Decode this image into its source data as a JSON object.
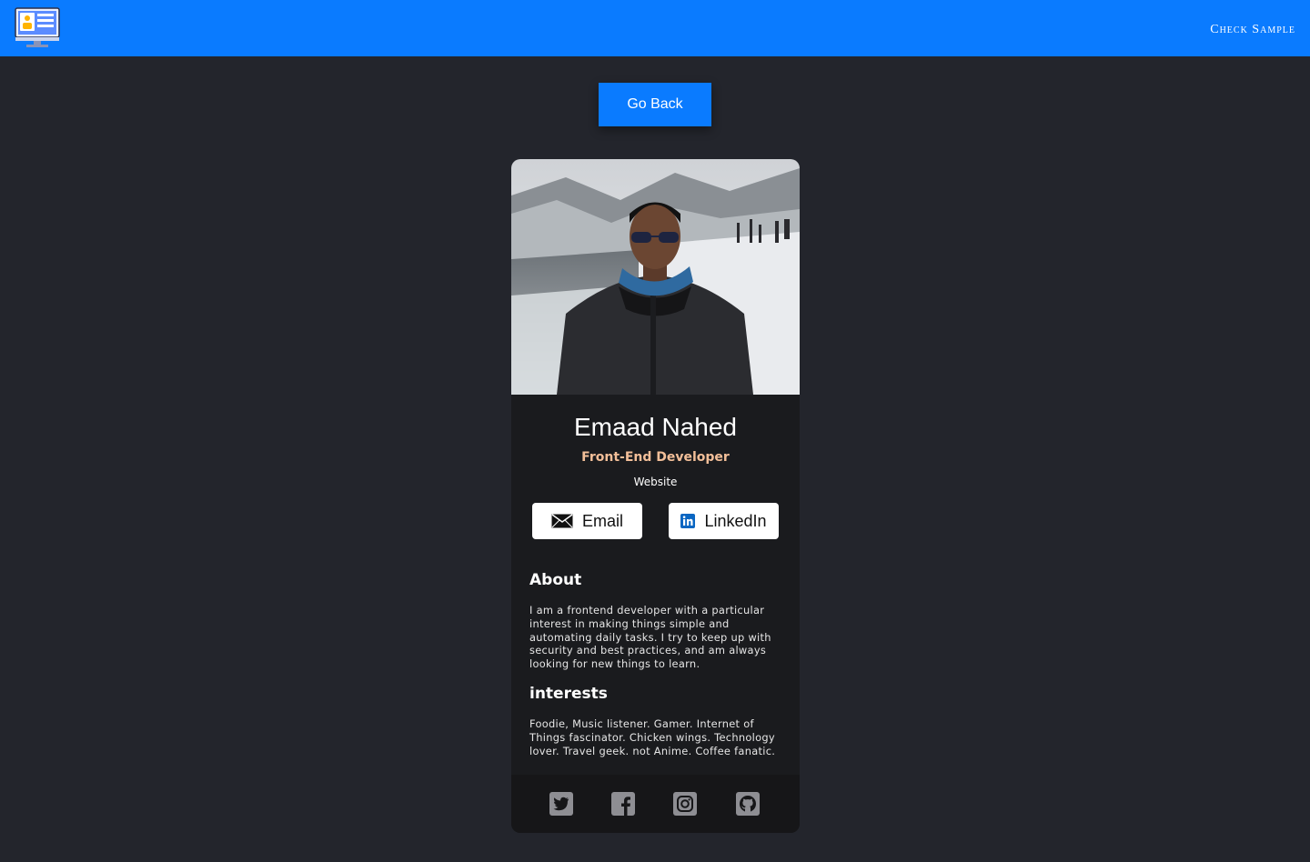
{
  "header": {
    "logo_icon": "profile-monitor-icon",
    "check_sample": "Check Sample"
  },
  "go_back": "Go Back",
  "profile": {
    "photo_alt": "Emaad Nahed",
    "name": "Emaad Nahed",
    "role": "Front-End Developer",
    "website": "Website",
    "email_label": "Email",
    "linkedin_label": "LinkedIn"
  },
  "about": {
    "title": "About",
    "text": "I am a frontend developer with a particular interest in making things simple and automating daily tasks. I try to keep up with security and best practices, and am always looking for new things to learn."
  },
  "interests": {
    "title": "interests",
    "text": "Foodie, Music listener. Gamer. Internet of Things fascinator. Chicken wings. Technology lover. Travel geek. not Anime. Coffee fanatic."
  },
  "footer": {
    "icons": [
      "twitter-icon",
      "facebook-icon",
      "instagram-icon",
      "github-icon"
    ]
  },
  "colors": {
    "accent": "#0a7bff",
    "background": "#23252c",
    "card": "#1a1b1e",
    "role": "#f3bf99"
  }
}
